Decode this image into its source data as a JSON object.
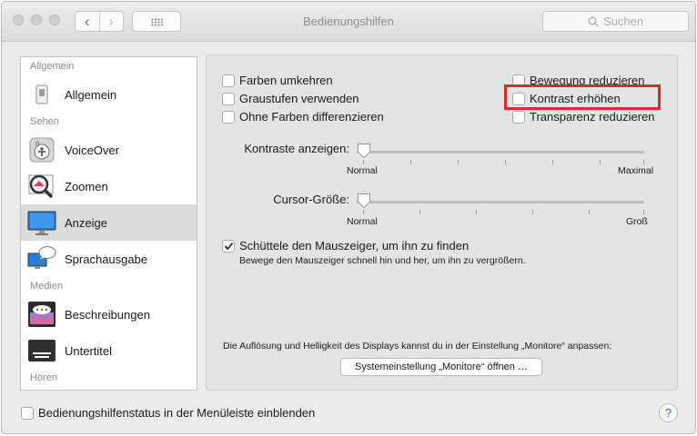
{
  "window": {
    "title": "Bedienungshilfen",
    "search_placeholder": "Suchen"
  },
  "sidebar": {
    "sections": {
      "allgemein": "Allgemein",
      "sehen": "Sehen",
      "medien": "Medien",
      "hoeren": "Hören"
    },
    "items": [
      {
        "label": "Allgemein",
        "icon": "switch-icon"
      },
      {
        "label": "VoiceOver",
        "icon": "voiceover-icon"
      },
      {
        "label": "Zoomen",
        "icon": "zoom-icon"
      },
      {
        "label": "Anzeige",
        "icon": "display-icon",
        "selected": true
      },
      {
        "label": "Sprachausgabe",
        "icon": "speech-icon"
      },
      {
        "label": "Beschreibungen",
        "icon": "descriptions-icon"
      },
      {
        "label": "Untertitel",
        "icon": "captions-icon"
      }
    ]
  },
  "options": {
    "invert_colors": {
      "label": "Farben umkehren",
      "checked": false
    },
    "grayscale": {
      "label": "Graustufen verwenden",
      "checked": false
    },
    "differentiate": {
      "label": "Ohne Farben differenzieren",
      "checked": false
    },
    "reduce_motion": {
      "label": "Bewegung reduzieren",
      "checked": false
    },
    "increase_contrast": {
      "label": "Kontrast erhöhen",
      "checked": false
    },
    "reduce_transparency": {
      "label": "Transparenz reduzieren",
      "checked": false
    }
  },
  "sliders": {
    "contrast": {
      "label": "Kontraste anzeigen:",
      "min_label": "Normal",
      "max_label": "Maximal",
      "value": 0
    },
    "cursor": {
      "label": "Cursor-Größe:",
      "min_label": "Normal",
      "max_label": "Groß",
      "value": 0
    }
  },
  "shake": {
    "label": "Schüttele den Mauszeiger, um ihn zu finden",
    "checked": true,
    "description": "Bewege den Mauszeiger schnell hin und her, um ihn zu vergrößern."
  },
  "display_note": "Die Auflösung und Helligkeit des Displays kannst du in der Einstellung „Monitore“ anpassen:",
  "monitors_button": "Systemeinstellung „Monitore“ öffnen …",
  "menubar_option": {
    "label": "Bedienungshilfenstatus in der Menüleiste einblenden",
    "checked": false
  },
  "help": "?",
  "colors": {
    "highlight": "#e0282c",
    "accent": "#2e6bd0",
    "selected_row": "#dcdcdc"
  }
}
